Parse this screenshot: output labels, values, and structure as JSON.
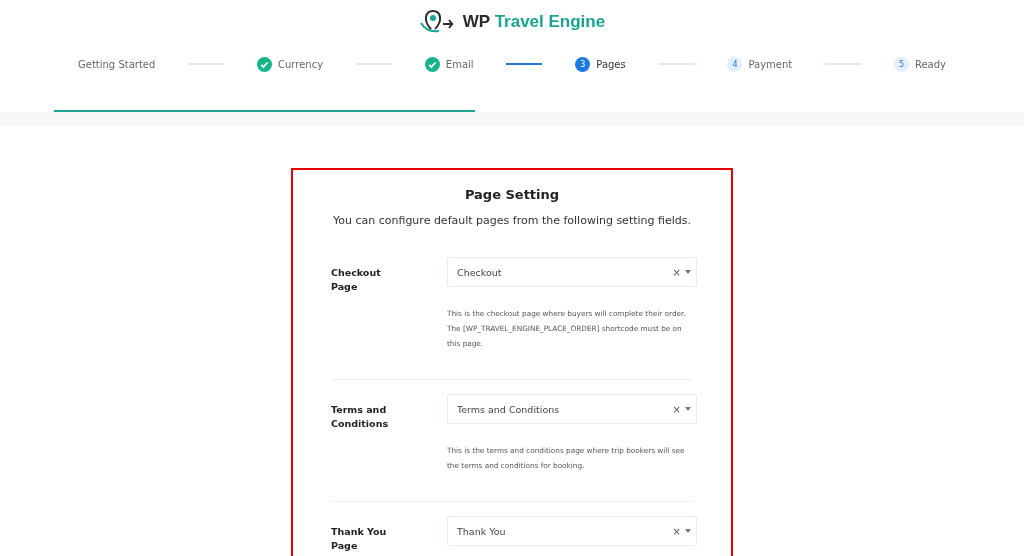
{
  "logo": {
    "brand_dark": "WP",
    "brand_accent": "Travel Engine"
  },
  "steps": [
    {
      "label": "Getting Started",
      "completed": false,
      "selected": false
    },
    {
      "label": "Currency",
      "completed": true,
      "selected": false
    },
    {
      "label": "Email",
      "completed": true,
      "selected": false
    },
    {
      "label": "Pages",
      "completed": false,
      "selected": true,
      "number": "3"
    },
    {
      "label": "Payment",
      "completed": false,
      "selected": false,
      "number": "4"
    },
    {
      "label": "Ready",
      "completed": false,
      "selected": false,
      "number": "5"
    }
  ],
  "card": {
    "title": "Page Setting",
    "subtitle": "You can configure default pages from the following setting fields.",
    "fields": [
      {
        "label": "Checkout Page",
        "value": "Checkout",
        "clear": "×",
        "help": "This is the checkout page where buyers will complete their order. The [WP_TRAVEL_ENGINE_PLACE_ORDER] shortcode must be on this page."
      },
      {
        "label": "Terms and Conditions",
        "value": "Terms and Conditions",
        "clear": "×",
        "help": "This is the terms and conditions page where trip bookers will see the terms and conditions for booking."
      },
      {
        "label": "Thank You Page",
        "value": "Thank You",
        "clear": "×"
      }
    ]
  }
}
